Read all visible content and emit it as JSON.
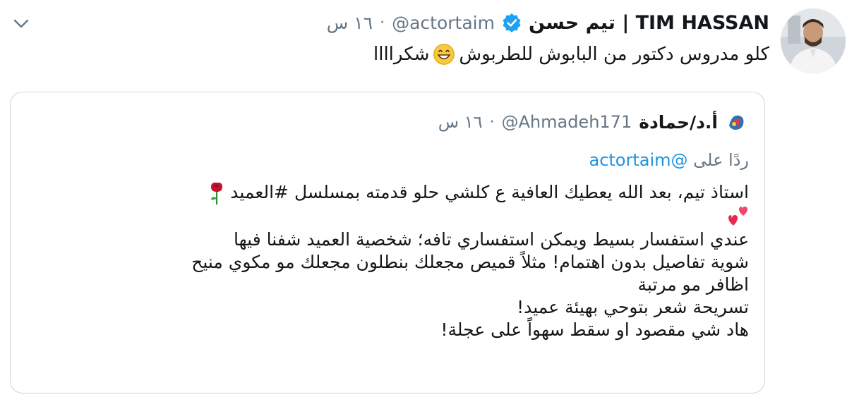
{
  "tweet": {
    "display_name": "تيم حسن | TIM HASSAN",
    "handle": "@actortaim",
    "separator": "·",
    "time": "١٦ س",
    "text": "كلو مدروس دكتور من البابوش للطربوش",
    "text_suffix": "شكراااا",
    "verified": true,
    "emoji": "grinning-face-icon"
  },
  "quoted": {
    "display_name": "أ.د/حمادة",
    "handle": "@Ahmadeh171",
    "separator": "·",
    "time": "١٦ س",
    "reply_prefix": "ردًا على",
    "reply_to": "@actortaim",
    "lines": [
      "استاذ تيم، بعد الله يعطيك العافية ع كلشي حلو قدمته بمسلسل",
      "#العميد",
      "عندي استفسار بسيط ويمكن استفساري تافه؛ شخصية العميد شفنا فيها",
      "شوية تفاصيل بدون اهتمام! مثلاً قميص مجعلك بنطلون مجعلك مو مكوي منيح",
      "اظافر مو مرتبة",
      "تسريحة شعر بتوحي بهيئة عميد!",
      "هاد شي مقصود او سقط سهواً على عجلة!"
    ]
  },
  "colors": {
    "text": "#14171a",
    "muted": "#657786",
    "link": "#1b95e0",
    "verified": "#1da1f2",
    "border": "#ccd6dd"
  }
}
